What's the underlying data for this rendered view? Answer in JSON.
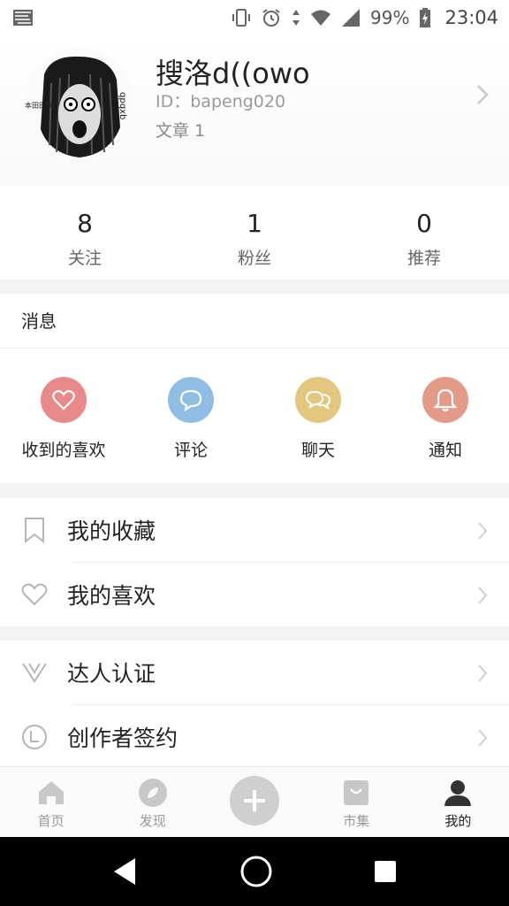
{
  "status_bar": {
    "battery": "99%",
    "time": "23:04"
  },
  "profile": {
    "name": "搜洛d((owo",
    "id": "ID：bapeng020",
    "articles": "文章 1"
  },
  "stats": [
    {
      "num": "8",
      "label": "关注"
    },
    {
      "num": "1",
      "label": "粉丝"
    },
    {
      "num": "0",
      "label": "推荐"
    }
  ],
  "messages": {
    "title": "消息",
    "items": [
      {
        "label": "收到的喜欢",
        "icon": "heart-icon",
        "color": "#e88a8a"
      },
      {
        "label": "评论",
        "icon": "comment-icon",
        "color": "#8fbde3"
      },
      {
        "label": "聊天",
        "icon": "chat-icon",
        "color": "#e3c77f"
      },
      {
        "label": "通知",
        "icon": "bell-icon",
        "color": "#e39a86"
      }
    ]
  },
  "menu1": [
    {
      "label": "我的收藏",
      "icon": "bookmark-icon"
    },
    {
      "label": "我的喜欢",
      "icon": "heart-outline-icon"
    }
  ],
  "menu2": [
    {
      "label": "达人认证",
      "icon": "v-badge-icon"
    },
    {
      "label": "创作者签约",
      "icon": "contract-icon"
    }
  ],
  "bottom_nav": [
    {
      "label": "首页",
      "icon": "home-icon"
    },
    {
      "label": "发现",
      "icon": "discover-icon"
    },
    {
      "label": "",
      "icon": "add-icon"
    },
    {
      "label": "市集",
      "icon": "shop-bag-icon"
    },
    {
      "label": "我的",
      "icon": "profile-icon",
      "active": true
    }
  ]
}
